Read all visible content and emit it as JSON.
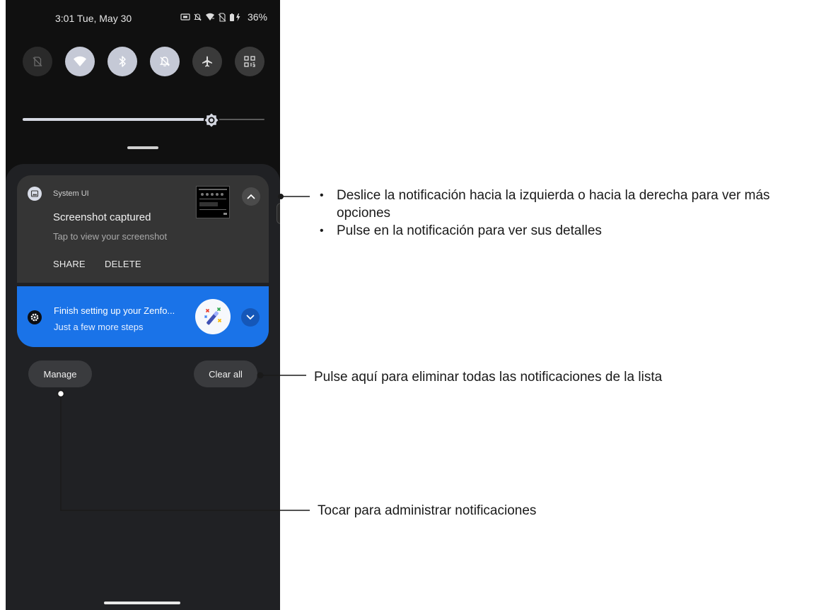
{
  "status_bar": {
    "time": "3:01 Tue, May 30",
    "battery": "36%",
    "icons": [
      "screenshot-icon",
      "bell-off-icon",
      "wifi-icon",
      "no-sim-icon",
      "battery-charging-icon"
    ]
  },
  "quick_settings": {
    "tiles": [
      {
        "name": "tile-no-sim",
        "icon": "no-sim-icon",
        "state": "off"
      },
      {
        "name": "tile-wifi",
        "icon": "wifi-icon",
        "state": "on"
      },
      {
        "name": "tile-bluetooth",
        "icon": "bluetooth-icon",
        "state": "on"
      },
      {
        "name": "tile-do-not-disturb",
        "icon": "bell-off-icon",
        "state": "on"
      },
      {
        "name": "tile-airplane",
        "icon": "airplane-icon",
        "state": "dim"
      },
      {
        "name": "tile-qr-scanner",
        "icon": "qr-code-icon",
        "state": "dim"
      }
    ],
    "brightness_level": 0.78
  },
  "notifications": [
    {
      "app_name": "System UI",
      "title": "Screenshot captured",
      "text": "Tap to view your screenshot",
      "actions": [
        "SHARE",
        "DELETE"
      ]
    },
    {
      "title": "Finish setting up your Zenfo...",
      "text": "Just a few more steps"
    }
  ],
  "buttons": {
    "manage": "Manage",
    "clear_all": "Clear all"
  },
  "annotations": {
    "swipe": "Deslice la notificación hacia la izquierda o hacia la derecha para ver más opciones",
    "tap_details": "Pulse en la notificación para ver sus detalles",
    "clear_all": "Pulse aquí para eliminar todas las notificaciones de la lista",
    "manage": "Tocar para administrar notificaciones"
  },
  "colors": {
    "accent": "#1a73e8",
    "shade_background": "#202124",
    "callout_line": "#1a1a1a"
  }
}
